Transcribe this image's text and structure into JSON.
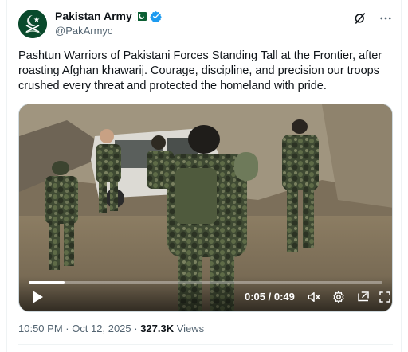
{
  "account": {
    "display_name": "Pakistan Army",
    "handle": "@PakArmyc",
    "verified": true,
    "avatar_icon": "pakistan-army-crest",
    "flag_icon": "pakistan-flag"
  },
  "header_actions": [
    "grok-icon",
    "more-icon"
  ],
  "tweet": {
    "text": "Pashtun Warriors of Pakistani Forces Standing Tall at the Frontier, after roasting Afghan khawarij. Courage, discipline, and precision our troops crushed every threat and protected the homeland with pride."
  },
  "video": {
    "time_readout": "0:05 / 0:49",
    "progress_fraction": 0.102,
    "controls": [
      "play-icon",
      "volume-muted-icon",
      "settings-icon",
      "picture-in-picture-icon",
      "fullscreen-icon"
    ]
  },
  "meta": {
    "timestamp": "10:50 PM · Oct 12, 2025 · ",
    "views_count": "327.3K",
    "views_label": " Views"
  },
  "colors": {
    "verified_blue": "#1d9bf0",
    "text_primary": "#0f1419",
    "text_secondary": "#536471",
    "avatar_green": "#0a4a2c"
  }
}
